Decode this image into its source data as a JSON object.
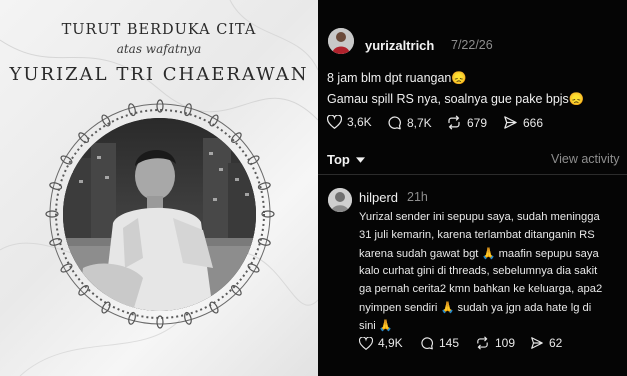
{
  "memorial": {
    "line1": "TURUT BERDUKA CITA",
    "line2": "atas wafatnya",
    "name": "YURIZAL TRI CHAERAWAN"
  },
  "post": {
    "username": "yurizaltrich",
    "date": "7/22/26",
    "text_line1": "8 jam blm dpt ruangan",
    "text_line1_emoji": "😞",
    "text_line2": "Gamau spill RS nya, soalnya gue pake bpjs",
    "text_line2_emoji": "😞",
    "likes": "3,6K",
    "replies": "8,7K",
    "reposts": "679",
    "shares": "666"
  },
  "sort": {
    "label": "Top",
    "view_activity": "View activity"
  },
  "comment": {
    "username": "hilperd",
    "time": "21h",
    "lines": [
      "Yurizal sender ini sepupu saya, sudah meningga",
      "31 juli kemarin, karena terlambat ditanganin RS",
      "karena sudah gawat bgt 🙏 maafin sepupu saya",
      "kalo curhat gini di threads, sebelumnya dia sakit",
      "ga pernah cerita2 kmn bahkan ke keluarga, apa2",
      "nyimpen sendiri 🙏 sudah ya jgn ada hate lg di",
      "sini 🙏"
    ],
    "likes": "4,9K",
    "replies": "145",
    "reposts": "109",
    "shares": "62"
  },
  "colors": {
    "background": "#050505",
    "text": "#f2f2f2",
    "muted": "#8e8e8e",
    "memorial_bg": "#eeeeee"
  }
}
